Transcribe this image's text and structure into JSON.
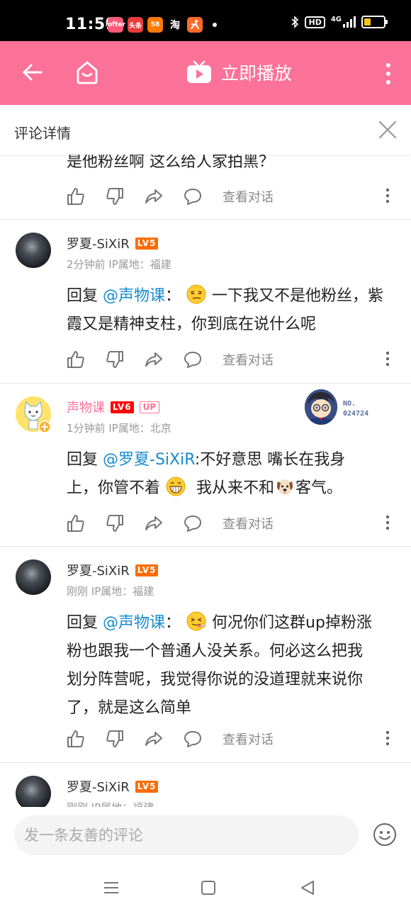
{
  "status_bar": {
    "time": "11:59",
    "network": "4G",
    "hd": "HD",
    "battery_level": 0.35,
    "app_icons": [
      {
        "name": "lofter-app-icon",
        "label": "lofter",
        "color": "#ff5a7a"
      },
      {
        "name": "toutiao-app-icon",
        "label": "头条",
        "color": "#e93c3c"
      },
      {
        "name": "58-app-icon",
        "label": "58",
        "color": "#ff7a00"
      },
      {
        "name": "taobao-app-icon",
        "label": "淘",
        "color": "#000000"
      },
      {
        "name": "running-app-icon",
        "label": "",
        "color": "#ff6a2a"
      }
    ]
  },
  "header": {
    "play_label": "立即播放",
    "bg_color": "#fb7299"
  },
  "title_bar": {
    "title": "评论详情"
  },
  "previous_comment": {
    "text_tail": "是他粉丝啊 这么给人家拍黑？",
    "view_conversation": "查看对话"
  },
  "comments": [
    {
      "username": "罗夏-SiXiR",
      "level": "LV5",
      "time": "2分钟前",
      "ip_label": "IP属地：福建",
      "reply_prefix": "回复",
      "mention": "@声物课",
      "colon": "：",
      "lines": [
        "一下我又不是他粉丝，紫",
        "霞又是精神支柱，你到底在说什么呢"
      ],
      "view_conversation": "查看对话"
    },
    {
      "username": "声物课",
      "level": "LV6",
      "up_badge": "UP",
      "time": "1分钟前",
      "ip_label": "IP属地：北京",
      "fan_no_label": "NO.",
      "fan_no_value": "024724",
      "reply_prefix": "回复",
      "mention": "@罗夏-SiXiR",
      "colon": ":",
      "line1_rest": "不好意思 嘴长在我身",
      "line2_a": "上，你管不着",
      "line2_b": "我从来不和",
      "line2_c": "客气。",
      "view_conversation": "查看对话"
    },
    {
      "username": "罗夏-SiXiR",
      "level": "LV5",
      "time": "刚刚",
      "ip_label": "IP属地：福建",
      "reply_prefix": "回复",
      "mention": "@声物课",
      "colon": "：",
      "lines": [
        "何况你们这群up掉粉涨",
        "粉也跟我一个普通人没关系。何必这么把我",
        "划分阵营呢，我觉得你说的没道理就来说你",
        "了，就是这么简单"
      ],
      "view_conversation": "查看对话"
    },
    {
      "username": "罗夏-SiXiR",
      "level": "LV5",
      "time": "刚刚",
      "ip_label": "IP属地：福建"
    }
  ],
  "input": {
    "placeholder": "发一条友善的评论"
  }
}
